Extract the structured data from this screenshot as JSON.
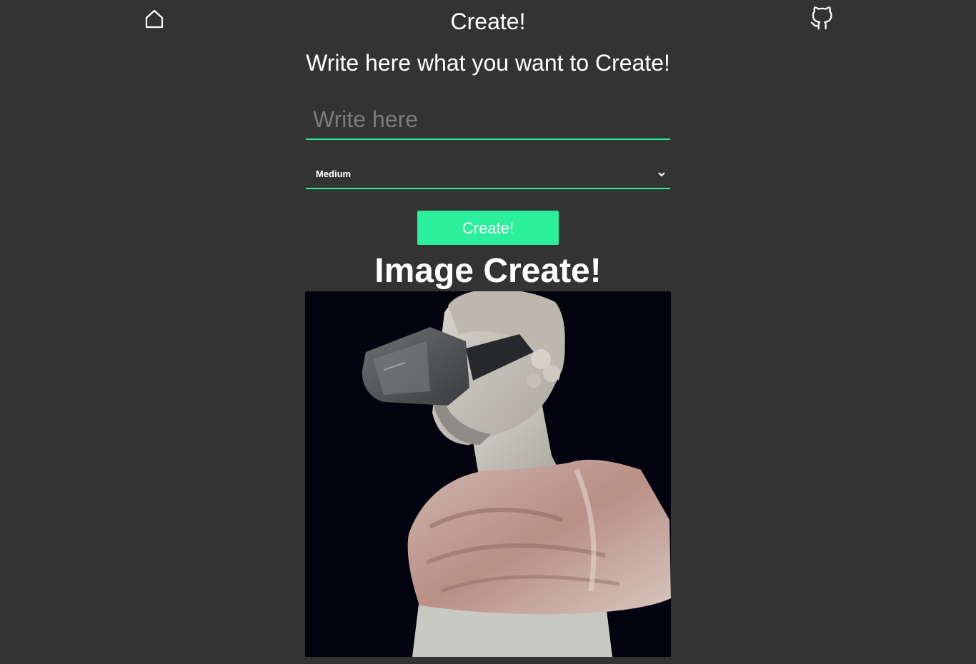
{
  "header": {
    "title": "Create!",
    "home_icon": "home-icon",
    "github_icon": "github-icon"
  },
  "form": {
    "heading": "Write here what you want to Create!",
    "prompt_placeholder": "Write here",
    "prompt_value": "",
    "size_selected": "Medium",
    "submit_label": "Create!"
  },
  "result": {
    "heading": "Image Create!",
    "image_alt": "Generated image: marble bust wearing a VR headset"
  },
  "colors": {
    "background": "#333333",
    "accent": "#2bef9c",
    "text": "#ffffff",
    "placeholder": "#7b7b7b"
  }
}
